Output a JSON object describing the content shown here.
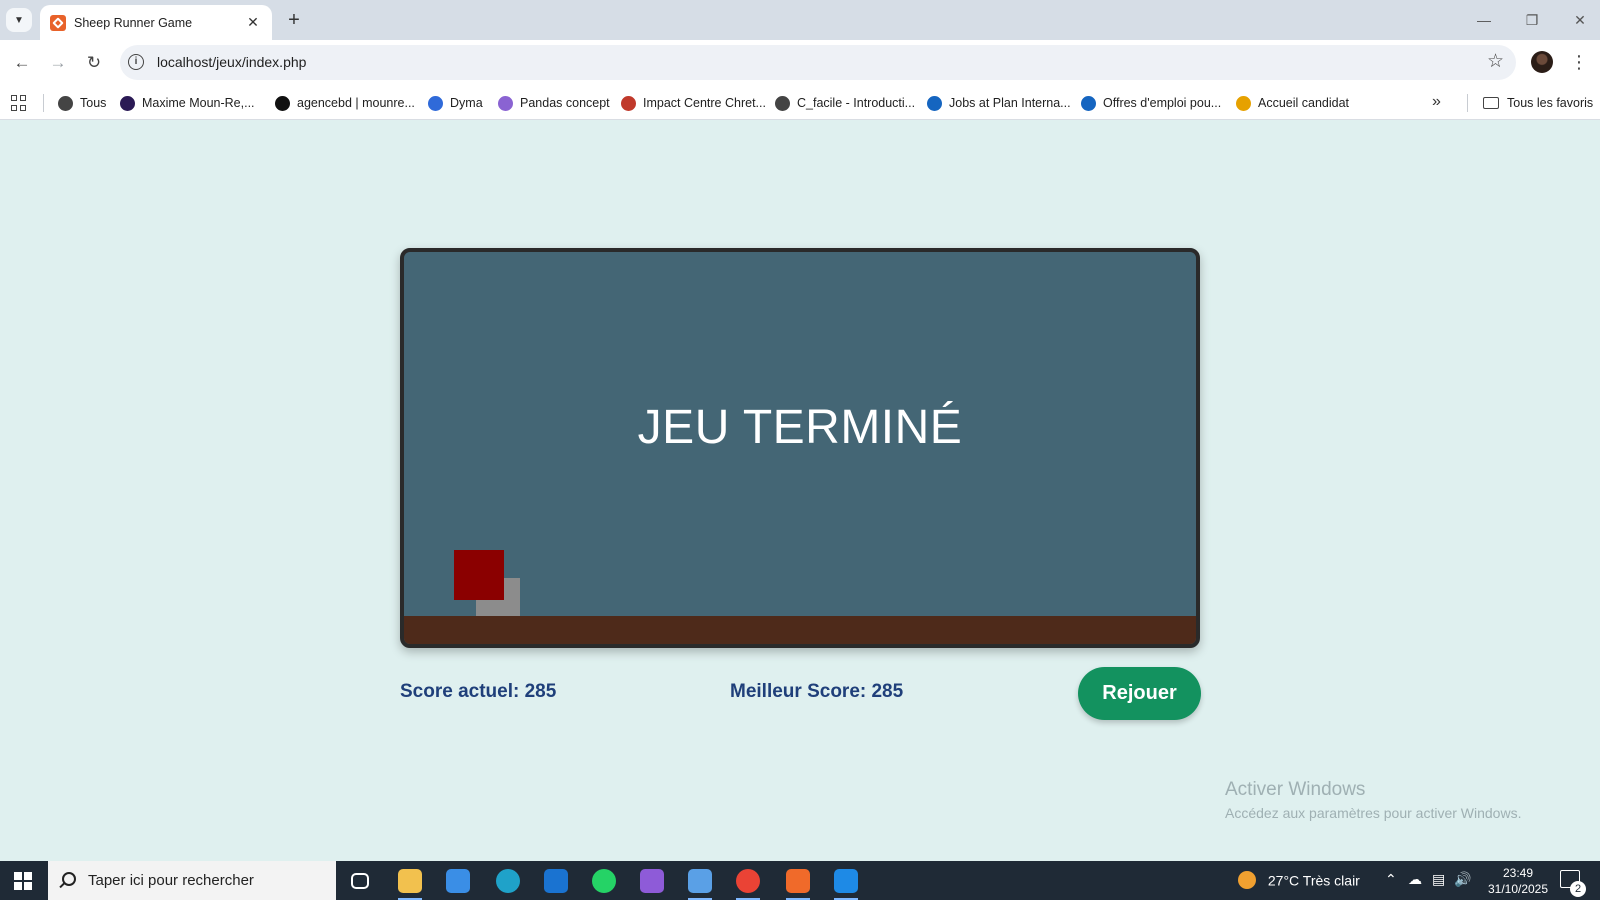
{
  "browser": {
    "tab_title": "Sheep Runner Game",
    "url": "localhost/jeux/index.php",
    "bookmarks": [
      {
        "label": "Tous",
        "icon": "globe-icon",
        "color": "#444444"
      },
      {
        "label": "Maxime Moun-Re,...",
        "icon": "o6-icon",
        "color": "#2b1a55"
      },
      {
        "label": "agencebd | mounre...",
        "icon": "lightning-icon",
        "color": "#111111"
      },
      {
        "label": "Dyma",
        "icon": "dyma-icon",
        "color": "#2f6ad9"
      },
      {
        "label": "Pandas concept",
        "icon": "spiral-icon",
        "color": "#8a63d2"
      },
      {
        "label": "Impact Centre Chret...",
        "icon": "ic-icon",
        "color": "#c0392b"
      },
      {
        "label": "C_facile - Introducti...",
        "icon": "globe-icon",
        "color": "#444444"
      },
      {
        "label": "Jobs at Plan Interna...",
        "icon": "eye-icon",
        "color": "#1565c0"
      },
      {
        "label": "Offres d'emploi pou...",
        "icon": "eye-icon",
        "color": "#1565c0"
      },
      {
        "label": "Accueil candidat",
        "icon": "w-icon",
        "color": "#e6a100"
      }
    ],
    "all_bookmarks_label": "Tous les favoris"
  },
  "game": {
    "status_text": "JEU TERMINÉ",
    "current_score_label": "Score actuel: 285",
    "best_score_label": "Meilleur Score: 285",
    "replay_label": "Rejouer",
    "colors": {
      "sky": "#446675",
      "ground": "#4e2a1a",
      "player": "#8b0000",
      "obstacle": "#8c8c8c",
      "score_text": "#1f3f7a",
      "replay_button": "#13925f"
    }
  },
  "watermark": {
    "title": "Activer Windows",
    "subtitle": "Accédez aux paramètres pour activer Windows."
  },
  "taskbar": {
    "search_placeholder": "Taper ici pour rechercher",
    "apps": [
      {
        "name": "task-view-icon",
        "color": "#ffffff"
      },
      {
        "name": "file-explorer-icon",
        "color": "#f2c14e"
      },
      {
        "name": "microsoft-store-icon",
        "color": "#3a8ee6"
      },
      {
        "name": "edge-icon",
        "color": "#1fa2c9"
      },
      {
        "name": "outlook-icon",
        "color": "#1a73d1"
      },
      {
        "name": "whatsapp-icon",
        "color": "#25d366"
      },
      {
        "name": "clapper-app-icon",
        "color": "#8e5bd8"
      },
      {
        "name": "remote-desktop-icon",
        "color": "#5aa0e6"
      },
      {
        "name": "chrome-icon",
        "color": "#ea4335"
      },
      {
        "name": "xampp-icon",
        "color": "#f06a2a"
      },
      {
        "name": "vscode-icon",
        "color": "#1e8ae6"
      }
    ],
    "weather": "27°C  Très clair",
    "time": "23:49",
    "date": "31/10/2025",
    "notification_count": "2"
  }
}
